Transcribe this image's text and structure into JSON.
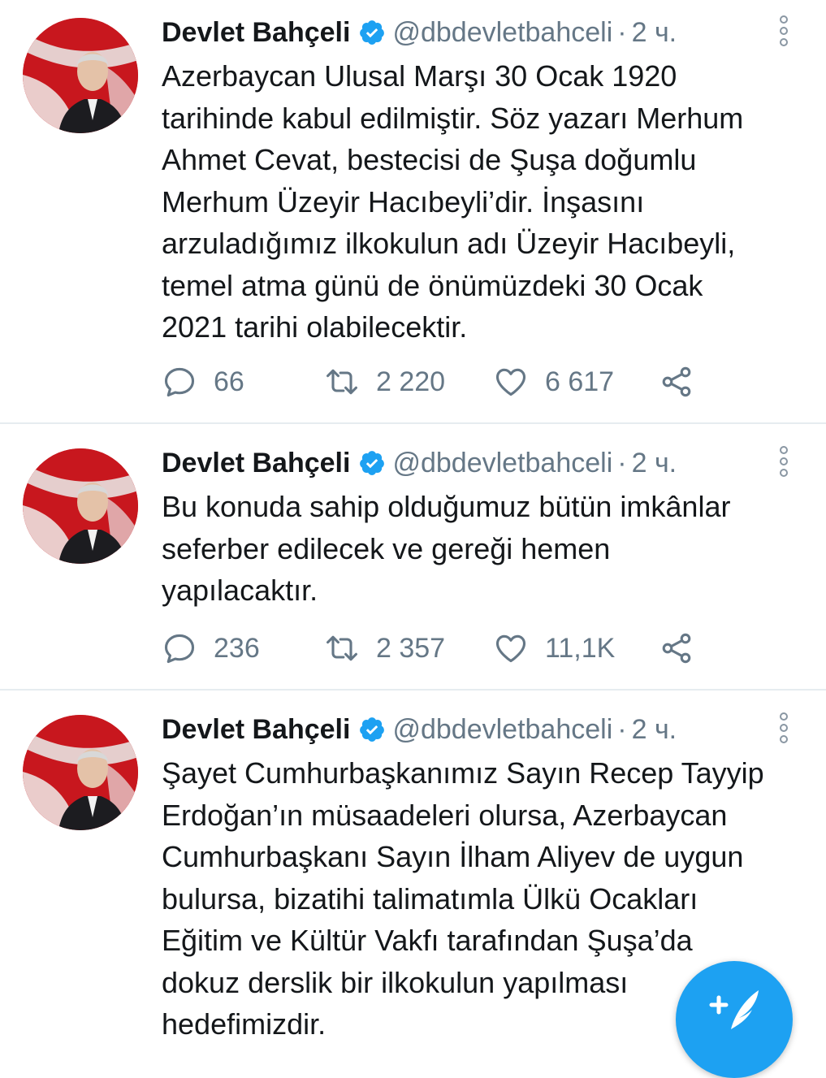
{
  "tweets": [
    {
      "author": "Devlet Bahçeli",
      "handle": "@dbdevletbahceli",
      "separator": "·",
      "time": "2 ч.",
      "text": "Azerbaycan Ulusal Marşı 30 Ocak 1920\ntarihinde kabul edilmiştir. Söz yazarı Merhum\nAhmet Cevat, bestecisi de Şuşa doğumlu\nMerhum Üzeyir Hacıbeyli’dir. İnşasını\narzuladığımız ilkokulun adı Üzeyir Hacıbeyli,\ntemel atma günü de önümüzdeki 30 Ocak\n2021 tarihi olabilecektir.",
      "replies": "66",
      "retweets": "2 220",
      "likes": "6 617"
    },
    {
      "author": "Devlet Bahçeli",
      "handle": "@dbdevletbahceli",
      "separator": "·",
      "time": "2 ч.",
      "text": "Bu konuda sahip olduğumuz bütün imkânlar\nseferber edilecek ve gereği hemen\nyapılacaktır.",
      "replies": "236",
      "retweets": "2 357",
      "likes": "11,1K"
    },
    {
      "author": "Devlet Bahçeli",
      "handle": "@dbdevletbahceli",
      "separator": "·",
      "time": "2 ч.",
      "text": "Şayet Cumhurbaşkanımız Sayın Recep Tayyip\nErdoğan’ın müsaadeleri olursa, Azerbaycan\nCumhurbaşkanı Sayın İlham Aliyev de uygun\nbulursa, bizatihi talimatımla Ülkü Ocakları\nEğitim ve Kültür Vakfı tarafından Şuşa’da\ndokuz derslik bir ilkokulun yapılması\nhedefimizdir."
    }
  ],
  "icons": {
    "verified": "verified-badge-icon",
    "more": "more-vertical-icon",
    "reply": "reply-icon",
    "retweet": "retweet-icon",
    "like": "heart-icon",
    "share": "share-icon",
    "compose": "compose-tweet-icon"
  },
  "colors": {
    "accent": "#1da1f2",
    "text": "#14171a",
    "secondary": "#657786",
    "divider": "#e6ecf0"
  }
}
